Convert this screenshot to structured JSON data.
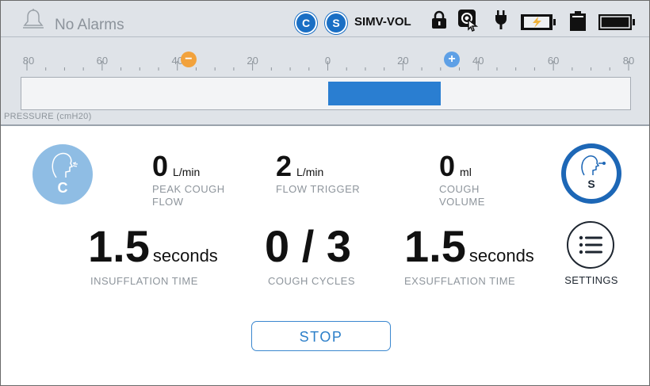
{
  "header": {
    "alarm_text": "No Alarms",
    "badge_c": "C",
    "badge_s": "S",
    "mode": "SIMV-VOL",
    "icons": [
      "bell-icon",
      "lock-icon",
      "touch-icon",
      "plug-icon",
      "battery-charging-icon",
      "battery-removable-icon",
      "battery-internal-icon"
    ]
  },
  "pressure": {
    "tick_labels": [
      "80",
      "60",
      "40",
      "20",
      "0",
      "20",
      "40",
      "60",
      "80"
    ],
    "low_marker": "−",
    "high_marker": "+",
    "low_marker_value": -37,
    "high_marker_value": 33,
    "bar_range": [
      0,
      30
    ],
    "scale_range": [
      -80,
      80
    ],
    "caption": "PRESSURE (cmH20)",
    "colors": {
      "low_marker": "#f2a23c",
      "high_marker": "#5ea0e6",
      "bar": "#2a7ed1"
    }
  },
  "cough": {
    "left_letter": "C",
    "right_letter": "S"
  },
  "metrics": {
    "peak_cough_flow": {
      "value": "0",
      "unit": "L/min",
      "label": "PEAK COUGH FLOW"
    },
    "flow_trigger": {
      "value": "2",
      "unit": "L/min",
      "label": "FLOW TRIGGER"
    },
    "cough_volume": {
      "value": "0",
      "unit": "ml",
      "label": "COUGH VOLUME"
    }
  },
  "main": {
    "insufflation": {
      "value": "1.5",
      "unit": "seconds",
      "label": "INSUFFLATION TIME"
    },
    "cough_cycles": {
      "value": "0 / 3",
      "label": "COUGH CYCLES"
    },
    "exsufflation": {
      "value": "1.5",
      "unit": "seconds",
      "label": "EXSUFFLATION TIME"
    }
  },
  "settings_label": "SETTINGS",
  "stop_label": "STOP"
}
